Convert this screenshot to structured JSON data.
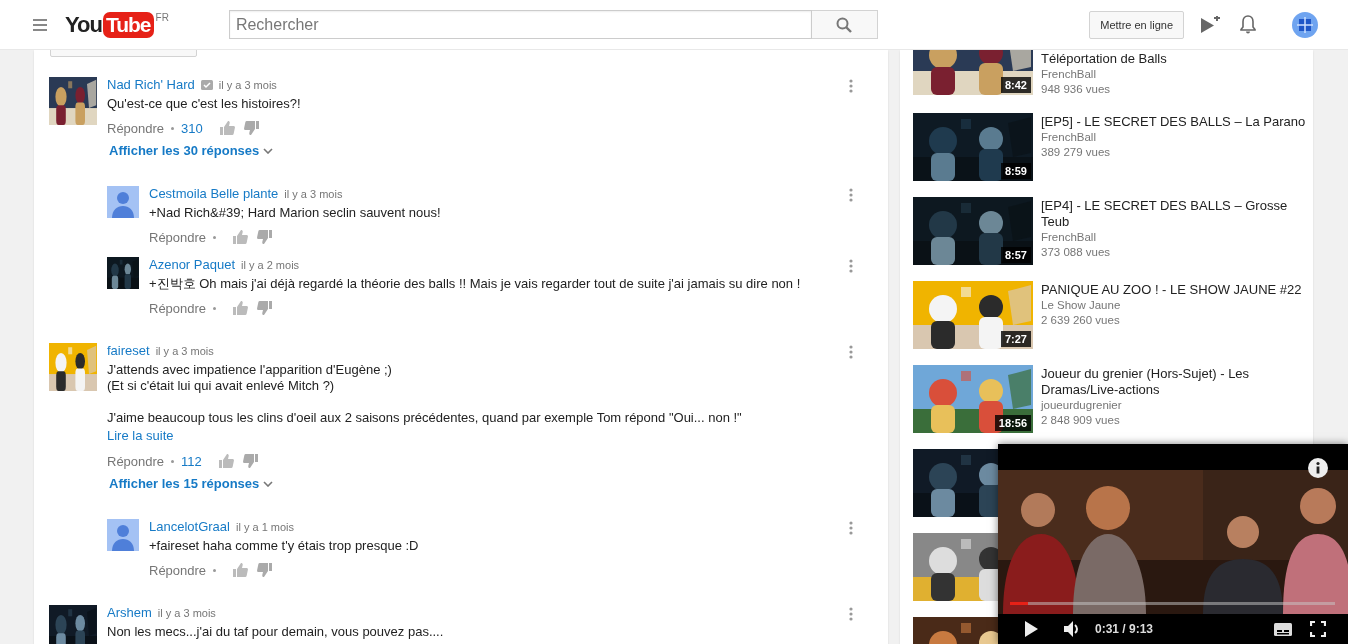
{
  "header": {
    "logo": {
      "word_1": "You",
      "word_2": "Tube",
      "region": "FR"
    },
    "search": {
      "placeholder": "Rechercher"
    },
    "upload_button": "Mettre en ligne"
  },
  "comments": [
    {
      "kind": "picture",
      "author": "Nad Rich' Hard",
      "verified": true,
      "time": "il y a 3 mois",
      "text": "Qu'est-ce que c'est les histoires?!",
      "reply_label": "Répondre",
      "likes": "310",
      "show_replies": "Afficher les 30 réponses",
      "replies": [
        {
          "kind": "default",
          "author": "Cestmoila Belle plante",
          "verified": false,
          "time": "il y a 3 mois",
          "text": "+Nad Rich&#39; Hard Marion seclin sauvent nous!",
          "reply_label": "Répondre"
        },
        {
          "kind": "picture",
          "author": "Azenor Paquet",
          "verified": false,
          "time": "il y a 2 mois",
          "text": "+진박호 Oh mais j'ai déjà regardé la théorie des balls !! Mais je vais regarder tout de suite j'ai jamais su dire non !",
          "reply_label": "Répondre"
        }
      ]
    },
    {
      "kind": "picture",
      "author": "faireset",
      "verified": false,
      "time": "il y a 3 mois",
      "text": "J'attends avec impatience l'apparition d'Eugène ;)\n(Et si c'était lui qui avait enlevé Mitch ?)\n\nJ'aime beaucoup tous les clins d'oeil aux 2 saisons précédentes, quand par exemple Tom répond \"Oui... non !\"",
      "read_more": "Lire la suite",
      "reply_label": "Répondre",
      "likes": "112",
      "show_replies": "Afficher les 15 réponses",
      "replies": [
        {
          "kind": "default",
          "author": "LancelotGraal",
          "verified": false,
          "time": "il y a 1 mois",
          "text": "+faireset haha comme t'y étais trop presque :D",
          "reply_label": "Répondre"
        }
      ]
    },
    {
      "kind": "picture",
      "author": "Arshem",
      "verified": false,
      "time": "il y a 3 mois",
      "text": "Non les mecs...j'ai du taf pour demain, vous pouvez pas...."
    }
  ],
  "related_videos": [
    {
      "kind": "video",
      "title": "Téléportation de Balls",
      "channel": "FrenchBall",
      "views": "948 936 vues",
      "duration": "8:42"
    },
    {
      "kind": "video",
      "title": "[EP5] - LE SECRET DES BALLS – La Parano",
      "channel": "FrenchBall",
      "views": "389 279 vues",
      "duration": "8:59"
    },
    {
      "kind": "video",
      "title": "[EP4] - LE SECRET DES BALLS – Grosse Teub",
      "channel": "FrenchBall",
      "views": "373 088 vues",
      "duration": "8:57"
    },
    {
      "kind": "video",
      "title": "PANIQUE AU ZOO ! - LE SHOW JAUNE #22",
      "channel": "Le Show Jaune",
      "views": "2 639 260 vues",
      "duration": "7:27"
    },
    {
      "kind": "video",
      "title": "Joueur du grenier (Hors-Sujet) - Les Dramas/Live-actions",
      "channel": "joueurdugrenier",
      "views": "2 848 909 vues",
      "duration": "18:56"
    },
    {
      "kind": "thumbnail-only"
    },
    {
      "kind": "thumbnail-only"
    },
    {
      "kind": "thumbnail-only"
    }
  ],
  "miniplayer": {
    "time": "0:31 / 9:13",
    "level": 0.055
  }
}
